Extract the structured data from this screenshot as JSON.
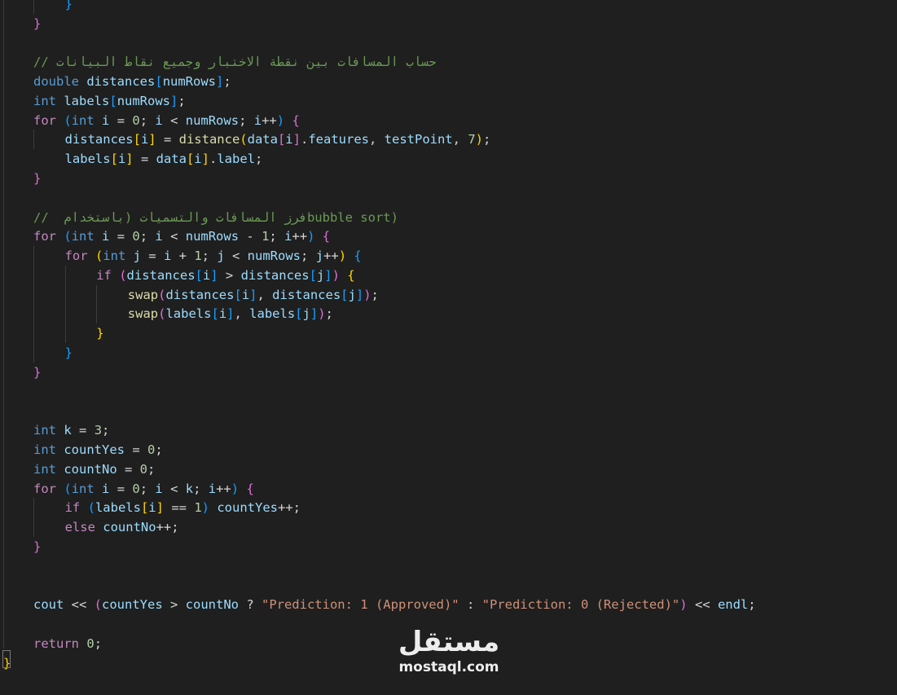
{
  "editor": {
    "language": "C++",
    "theme_colors": {
      "background": "#1f1f1f",
      "keyword": "#569cd6",
      "control": "#c586c0",
      "variable": "#9cdcfe",
      "function": "#dcdcaa",
      "number": "#b5cea8",
      "string": "#ce9178",
      "comment": "#6a9955",
      "bracket_1": "#ffd700",
      "bracket_2": "#da70d6",
      "bracket_3": "#179fff"
    },
    "lines": [
      {
        "indent": 1,
        "tokens": [
          {
            "t": "}",
            "c": "b3"
          }
        ]
      },
      {
        "indent": 0,
        "tokens": [
          {
            "t": "}",
            "c": "b2"
          }
        ]
      },
      {
        "indent": 0,
        "tokens": []
      },
      {
        "indent": 0,
        "tokens": [
          {
            "t": "// ",
            "c": "cmt"
          },
          {
            "t": "حساب المسافات بين نقطة الاختبار وجميع نقاط البيانات",
            "c": "cmt",
            "rtl": true
          }
        ]
      },
      {
        "indent": 0,
        "tokens": [
          {
            "t": "double",
            "c": "kw"
          },
          {
            "t": " ",
            "c": "pl"
          },
          {
            "t": "distances",
            "c": "var"
          },
          {
            "t": "[",
            "c": "b3"
          },
          {
            "t": "numRows",
            "c": "var"
          },
          {
            "t": "]",
            "c": "b3"
          },
          {
            "t": ";",
            "c": "pl"
          }
        ]
      },
      {
        "indent": 0,
        "tokens": [
          {
            "t": "int",
            "c": "kw"
          },
          {
            "t": " ",
            "c": "pl"
          },
          {
            "t": "labels",
            "c": "var"
          },
          {
            "t": "[",
            "c": "b3"
          },
          {
            "t": "numRows",
            "c": "var"
          },
          {
            "t": "]",
            "c": "b3"
          },
          {
            "t": ";",
            "c": "pl"
          }
        ]
      },
      {
        "indent": 0,
        "tokens": [
          {
            "t": "for",
            "c": "ctl"
          },
          {
            "t": " ",
            "c": "pl"
          },
          {
            "t": "(",
            "c": "b3"
          },
          {
            "t": "int",
            "c": "kw"
          },
          {
            "t": " ",
            "c": "pl"
          },
          {
            "t": "i",
            "c": "var"
          },
          {
            "t": " = ",
            "c": "op"
          },
          {
            "t": "0",
            "c": "num"
          },
          {
            "t": "; ",
            "c": "pl"
          },
          {
            "t": "i",
            "c": "var"
          },
          {
            "t": " < ",
            "c": "op"
          },
          {
            "t": "numRows",
            "c": "var"
          },
          {
            "t": "; ",
            "c": "pl"
          },
          {
            "t": "i",
            "c": "var"
          },
          {
            "t": "++",
            "c": "op"
          },
          {
            "t": ")",
            "c": "b3"
          },
          {
            "t": " ",
            "c": "pl"
          },
          {
            "t": "{",
            "c": "b2"
          }
        ]
      },
      {
        "indent": 1,
        "tokens": [
          {
            "t": "distances",
            "c": "var"
          },
          {
            "t": "[",
            "c": "b1"
          },
          {
            "t": "i",
            "c": "var"
          },
          {
            "t": "]",
            "c": "b1"
          },
          {
            "t": " = ",
            "c": "op"
          },
          {
            "t": "distance",
            "c": "fn"
          },
          {
            "t": "(",
            "c": "b1"
          },
          {
            "t": "data",
            "c": "var"
          },
          {
            "t": "[",
            "c": "b2"
          },
          {
            "t": "i",
            "c": "var"
          },
          {
            "t": "]",
            "c": "b2"
          },
          {
            "t": ".",
            "c": "pl"
          },
          {
            "t": "features",
            "c": "var"
          },
          {
            "t": ", ",
            "c": "pl"
          },
          {
            "t": "testPoint",
            "c": "var"
          },
          {
            "t": ", ",
            "c": "pl"
          },
          {
            "t": "7",
            "c": "num"
          },
          {
            "t": ")",
            "c": "b1"
          },
          {
            "t": ";",
            "c": "pl"
          }
        ]
      },
      {
        "indent": 1,
        "tokens": [
          {
            "t": "labels",
            "c": "var"
          },
          {
            "t": "[",
            "c": "b1"
          },
          {
            "t": "i",
            "c": "var"
          },
          {
            "t": "]",
            "c": "b1"
          },
          {
            "t": " = ",
            "c": "op"
          },
          {
            "t": "data",
            "c": "var"
          },
          {
            "t": "[",
            "c": "b1"
          },
          {
            "t": "i",
            "c": "var"
          },
          {
            "t": "]",
            "c": "b1"
          },
          {
            "t": ".",
            "c": "pl"
          },
          {
            "t": "label",
            "c": "var"
          },
          {
            "t": ";",
            "c": "pl"
          }
        ]
      },
      {
        "indent": 0,
        "tokens": [
          {
            "t": "}",
            "c": "b2"
          }
        ]
      },
      {
        "indent": 0,
        "tokens": []
      },
      {
        "indent": 0,
        "tokens": [
          {
            "t": "// ",
            "c": "cmt"
          },
          {
            "t": "فرز المسافات والتسميات (باستخدام ",
            "c": "cmt",
            "rtl": true
          },
          {
            "t": "bubble sort)",
            "c": "cmt"
          }
        ]
      },
      {
        "indent": 0,
        "tokens": [
          {
            "t": "for",
            "c": "ctl"
          },
          {
            "t": " ",
            "c": "pl"
          },
          {
            "t": "(",
            "c": "b3"
          },
          {
            "t": "int",
            "c": "kw"
          },
          {
            "t": " ",
            "c": "pl"
          },
          {
            "t": "i",
            "c": "var"
          },
          {
            "t": " = ",
            "c": "op"
          },
          {
            "t": "0",
            "c": "num"
          },
          {
            "t": "; ",
            "c": "pl"
          },
          {
            "t": "i",
            "c": "var"
          },
          {
            "t": " < ",
            "c": "op"
          },
          {
            "t": "numRows",
            "c": "var"
          },
          {
            "t": " - ",
            "c": "op"
          },
          {
            "t": "1",
            "c": "num"
          },
          {
            "t": "; ",
            "c": "pl"
          },
          {
            "t": "i",
            "c": "var"
          },
          {
            "t": "++",
            "c": "op"
          },
          {
            "t": ")",
            "c": "b3"
          },
          {
            "t": " ",
            "c": "pl"
          },
          {
            "t": "{",
            "c": "b2"
          }
        ]
      },
      {
        "indent": 1,
        "tokens": [
          {
            "t": "for",
            "c": "ctl"
          },
          {
            "t": " ",
            "c": "pl"
          },
          {
            "t": "(",
            "c": "b1"
          },
          {
            "t": "int",
            "c": "kw"
          },
          {
            "t": " ",
            "c": "pl"
          },
          {
            "t": "j",
            "c": "var"
          },
          {
            "t": " = ",
            "c": "op"
          },
          {
            "t": "i",
            "c": "var"
          },
          {
            "t": " + ",
            "c": "op"
          },
          {
            "t": "1",
            "c": "num"
          },
          {
            "t": "; ",
            "c": "pl"
          },
          {
            "t": "j",
            "c": "var"
          },
          {
            "t": " < ",
            "c": "op"
          },
          {
            "t": "numRows",
            "c": "var"
          },
          {
            "t": "; ",
            "c": "pl"
          },
          {
            "t": "j",
            "c": "var"
          },
          {
            "t": "++",
            "c": "op"
          },
          {
            "t": ")",
            "c": "b1"
          },
          {
            "t": " ",
            "c": "pl"
          },
          {
            "t": "{",
            "c": "b3"
          }
        ]
      },
      {
        "indent": 2,
        "tokens": [
          {
            "t": "if",
            "c": "ctl"
          },
          {
            "t": " ",
            "c": "pl"
          },
          {
            "t": "(",
            "c": "b2"
          },
          {
            "t": "distances",
            "c": "var"
          },
          {
            "t": "[",
            "c": "b3"
          },
          {
            "t": "i",
            "c": "var"
          },
          {
            "t": "]",
            "c": "b3"
          },
          {
            "t": " > ",
            "c": "op"
          },
          {
            "t": "distances",
            "c": "var"
          },
          {
            "t": "[",
            "c": "b3"
          },
          {
            "t": "j",
            "c": "var"
          },
          {
            "t": "]",
            "c": "b3"
          },
          {
            "t": ")",
            "c": "b2"
          },
          {
            "t": " ",
            "c": "pl"
          },
          {
            "t": "{",
            "c": "b1"
          }
        ]
      },
      {
        "indent": 3,
        "tokens": [
          {
            "t": "swap",
            "c": "fn"
          },
          {
            "t": "(",
            "c": "b2"
          },
          {
            "t": "distances",
            "c": "var"
          },
          {
            "t": "[",
            "c": "b3"
          },
          {
            "t": "i",
            "c": "var"
          },
          {
            "t": "]",
            "c": "b3"
          },
          {
            "t": ", ",
            "c": "pl"
          },
          {
            "t": "distances",
            "c": "var"
          },
          {
            "t": "[",
            "c": "b3"
          },
          {
            "t": "j",
            "c": "var"
          },
          {
            "t": "]",
            "c": "b3"
          },
          {
            "t": ")",
            "c": "b2"
          },
          {
            "t": ";",
            "c": "pl"
          }
        ]
      },
      {
        "indent": 3,
        "tokens": [
          {
            "t": "swap",
            "c": "fn"
          },
          {
            "t": "(",
            "c": "b2"
          },
          {
            "t": "labels",
            "c": "var"
          },
          {
            "t": "[",
            "c": "b3"
          },
          {
            "t": "i",
            "c": "var"
          },
          {
            "t": "]",
            "c": "b3"
          },
          {
            "t": ", ",
            "c": "pl"
          },
          {
            "t": "labels",
            "c": "var"
          },
          {
            "t": "[",
            "c": "b3"
          },
          {
            "t": "j",
            "c": "var"
          },
          {
            "t": "]",
            "c": "b3"
          },
          {
            "t": ")",
            "c": "b2"
          },
          {
            "t": ";",
            "c": "pl"
          }
        ]
      },
      {
        "indent": 2,
        "tokens": [
          {
            "t": "}",
            "c": "b1"
          }
        ]
      },
      {
        "indent": 1,
        "tokens": [
          {
            "t": "}",
            "c": "b3"
          }
        ]
      },
      {
        "indent": 0,
        "tokens": [
          {
            "t": "}",
            "c": "b2"
          }
        ]
      },
      {
        "indent": 0,
        "tokens": []
      },
      {
        "indent": 0,
        "tokens": []
      },
      {
        "indent": 0,
        "tokens": [
          {
            "t": "int",
            "c": "kw"
          },
          {
            "t": " ",
            "c": "pl"
          },
          {
            "t": "k",
            "c": "var"
          },
          {
            "t": " = ",
            "c": "op"
          },
          {
            "t": "3",
            "c": "num"
          },
          {
            "t": ";",
            "c": "pl"
          }
        ]
      },
      {
        "indent": 0,
        "tokens": [
          {
            "t": "int",
            "c": "kw"
          },
          {
            "t": " ",
            "c": "pl"
          },
          {
            "t": "countYes",
            "c": "var"
          },
          {
            "t": " = ",
            "c": "op"
          },
          {
            "t": "0",
            "c": "num"
          },
          {
            "t": ";",
            "c": "pl"
          }
        ]
      },
      {
        "indent": 0,
        "tokens": [
          {
            "t": "int",
            "c": "kw"
          },
          {
            "t": " ",
            "c": "pl"
          },
          {
            "t": "countNo",
            "c": "var"
          },
          {
            "t": " = ",
            "c": "op"
          },
          {
            "t": "0",
            "c": "num"
          },
          {
            "t": ";",
            "c": "pl"
          }
        ]
      },
      {
        "indent": 0,
        "tokens": [
          {
            "t": "for",
            "c": "ctl"
          },
          {
            "t": " ",
            "c": "pl"
          },
          {
            "t": "(",
            "c": "b3"
          },
          {
            "t": "int",
            "c": "kw"
          },
          {
            "t": " ",
            "c": "pl"
          },
          {
            "t": "i",
            "c": "var"
          },
          {
            "t": " = ",
            "c": "op"
          },
          {
            "t": "0",
            "c": "num"
          },
          {
            "t": "; ",
            "c": "pl"
          },
          {
            "t": "i",
            "c": "var"
          },
          {
            "t": " < ",
            "c": "op"
          },
          {
            "t": "k",
            "c": "var"
          },
          {
            "t": "; ",
            "c": "pl"
          },
          {
            "t": "i",
            "c": "var"
          },
          {
            "t": "++",
            "c": "op"
          },
          {
            "t": ")",
            "c": "b3"
          },
          {
            "t": " ",
            "c": "pl"
          },
          {
            "t": "{",
            "c": "b2"
          }
        ]
      },
      {
        "indent": 1,
        "tokens": [
          {
            "t": "if",
            "c": "ctl"
          },
          {
            "t": " ",
            "c": "pl"
          },
          {
            "t": "(",
            "c": "b3"
          },
          {
            "t": "labels",
            "c": "var"
          },
          {
            "t": "[",
            "c": "b1"
          },
          {
            "t": "i",
            "c": "var"
          },
          {
            "t": "]",
            "c": "b1"
          },
          {
            "t": " == ",
            "c": "op"
          },
          {
            "t": "1",
            "c": "num"
          },
          {
            "t": ")",
            "c": "b3"
          },
          {
            "t": " ",
            "c": "pl"
          },
          {
            "t": "countYes",
            "c": "var"
          },
          {
            "t": "++",
            "c": "op"
          },
          {
            "t": ";",
            "c": "pl"
          }
        ]
      },
      {
        "indent": 1,
        "tokens": [
          {
            "t": "else",
            "c": "ctl"
          },
          {
            "t": " ",
            "c": "pl"
          },
          {
            "t": "countNo",
            "c": "var"
          },
          {
            "t": "++",
            "c": "op"
          },
          {
            "t": ";",
            "c": "pl"
          }
        ]
      },
      {
        "indent": 0,
        "tokens": [
          {
            "t": "}",
            "c": "b2"
          }
        ]
      },
      {
        "indent": 0,
        "tokens": []
      },
      {
        "indent": 0,
        "tokens": []
      },
      {
        "indent": 0,
        "tokens": [
          {
            "t": "cout",
            "c": "var"
          },
          {
            "t": " << ",
            "c": "op"
          },
          {
            "t": "(",
            "c": "b2"
          },
          {
            "t": "countYes",
            "c": "var"
          },
          {
            "t": " > ",
            "c": "op"
          },
          {
            "t": "countNo",
            "c": "var"
          },
          {
            "t": " ? ",
            "c": "op"
          },
          {
            "t": "\"Prediction: 1 (Approved)\"",
            "c": "str"
          },
          {
            "t": " : ",
            "c": "op"
          },
          {
            "t": "\"Prediction: 0 (Rejected)\"",
            "c": "str"
          },
          {
            "t": ")",
            "c": "b2"
          },
          {
            "t": " << ",
            "c": "op"
          },
          {
            "t": "endl",
            "c": "var"
          },
          {
            "t": ";",
            "c": "pl"
          }
        ]
      },
      {
        "indent": 0,
        "tokens": []
      },
      {
        "indent": 0,
        "tokens": [
          {
            "t": "return",
            "c": "ctl"
          },
          {
            "t": " ",
            "c": "pl"
          },
          {
            "t": "0",
            "c": "num"
          },
          {
            "t": ";",
            "c": "pl"
          }
        ]
      },
      {
        "indent": -1,
        "tokens": [
          {
            "t": "}",
            "c": "b1"
          }
        ]
      }
    ],
    "guides": [
      {
        "line_from": 0,
        "line_to": 1,
        "level": 0
      },
      {
        "line_from": 7,
        "line_to": 8,
        "level": 0
      },
      {
        "line_from": 13,
        "line_to": 19,
        "level": 0
      },
      {
        "line_from": 14,
        "line_to": 18,
        "level": 1
      },
      {
        "line_from": 15,
        "line_to": 17,
        "level": 2
      },
      {
        "line_from": 26,
        "line_to": 28,
        "level": 0
      }
    ]
  },
  "watermark": {
    "logo_text": "مستقل",
    "url": "mostaql.com"
  }
}
